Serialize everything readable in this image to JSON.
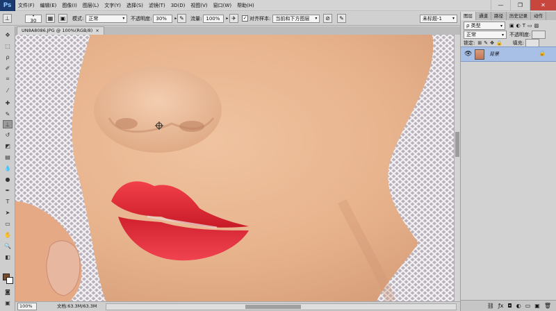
{
  "app": {
    "logo": "Ps"
  },
  "menu": [
    "文件(F)",
    "编辑(E)",
    "图像(I)",
    "图层(L)",
    "文字(Y)",
    "选择(S)",
    "滤镜(T)",
    "3D(D)",
    "视图(V)",
    "窗口(W)",
    "帮助(H)"
  ],
  "window_buttons": {
    "minimize": "—",
    "restore": "❐",
    "close": "✕"
  },
  "options": {
    "brush_size": "30",
    "mode_label": "模式:",
    "mode_value": "正常",
    "opacity_label": "不透明度:",
    "opacity_value": "30%",
    "flow_label": "流量:",
    "flow_value": "100%",
    "align_label": "对齐",
    "sample_label": "样本:",
    "sample_value": "当前和下方图层",
    "preset_value": "未标题-1"
  },
  "document": {
    "tab_title": "UN8A8086.JPG @ 100%(RGB/8)",
    "close": "×"
  },
  "status": {
    "zoom": "100%",
    "doc_info": "文档:63.3M/63.3M"
  },
  "panel": {
    "tabs": [
      "图层",
      "通道",
      "路径",
      "历史记录",
      "动作"
    ],
    "filter_label": "ρ 类型",
    "blend_mode": "正常",
    "opacity_label": "不透明度:",
    "lock_label": "锁定:",
    "fill_label": "填充:",
    "layer_name": "背景"
  },
  "colors": {
    "foreground": "#7a4a2a",
    "background": "#ffffff",
    "selected_layer": "#a9c0e6"
  }
}
